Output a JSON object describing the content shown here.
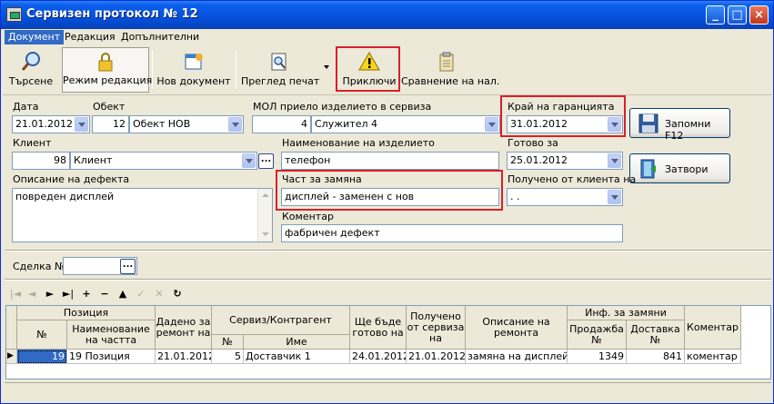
{
  "window": {
    "title": "Сервизен протокол № 12",
    "minimize": "_",
    "maximize": "□",
    "close": "×"
  },
  "menu": [
    {
      "label": "Документ"
    },
    {
      "label": "Редакция"
    },
    {
      "label": "Допълнителни"
    }
  ],
  "toolbar": {
    "search": "Търсене",
    "edit_mode": "Режим редакция",
    "new_doc": "Нов документ",
    "print_preview": "Преглед печат",
    "finish": "Приключи",
    "compare": "Сравнение на нал."
  },
  "form": {
    "date_label": "Дата",
    "date_value": "21.01.2012",
    "object_label": "Обект",
    "object_id": "12",
    "object_name": "Обект НОВ",
    "mol_label": "МОЛ приело изделието в сервиза",
    "mol_id": "4",
    "mol_name": "Служител 4",
    "warranty_label": "Край на гаранцията",
    "warranty_value": "31.01.2012",
    "client_label": "Клиент",
    "client_id": "98",
    "client_name": "Клиент",
    "product_label": "Наименование на изделието",
    "product_value": "телефон",
    "ready_label": "Готово за",
    "ready_value": "25.01.2012",
    "defect_label": "Описание на дефекта",
    "defect_value": "повреден дисплей",
    "part_label": "Част за замяна",
    "part_value": "дисплей - заменен с нов",
    "received_label": "Получено от клиента на",
    "received_value": ". .",
    "comment_label": "Коментар",
    "comment_value": "фабричен дефект",
    "deal_label": "Сделка №",
    "deal_value": "",
    "ellipsis": "..."
  },
  "buttons": {
    "save": "Запомни F12",
    "close": "Затвори"
  },
  "nav": [
    "|◄",
    "◄",
    "►",
    "►|",
    "+",
    "−",
    "▲",
    "✓",
    "✕",
    "↻"
  ],
  "grid": {
    "headers": {
      "position": "Позиция",
      "num": "№",
      "part_name": "Наименование на частта",
      "given": "Дадено за ремонт на",
      "service": "Сервиз/Контрагент",
      "service_num": "№",
      "service_name": "Име",
      "ready": "Ще бъде готово на",
      "received": "Получено от сервиза на",
      "repair_desc": "Описание на ремонта",
      "replace_info": "Инф. за замяни",
      "sale": "Продажба №",
      "delivery": "Доставка №",
      "comment": "Коментар"
    },
    "rows": [
      {
        "indicator": "▶",
        "num": "19",
        "part": "19 Позиция",
        "given": "21.01.2012",
        "svc_num": "5",
        "svc_name": "Доставчик 1",
        "ready": "24.01.2012",
        "received": "21.01.2012",
        "desc": "замяна на дисплей",
        "sale": "1349",
        "delivery": "841",
        "comment": "коментар"
      }
    ]
  }
}
